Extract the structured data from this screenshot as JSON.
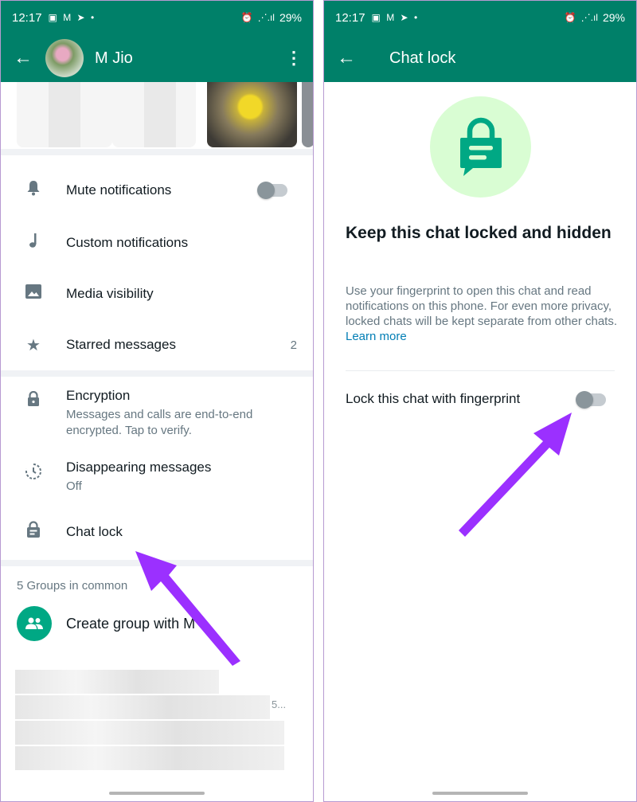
{
  "left": {
    "status": {
      "time": "12:17",
      "battery": "29%"
    },
    "header": {
      "back": "←",
      "title": "M Jio",
      "menu": "⋮"
    },
    "rows": {
      "mute": {
        "label": "Mute notifications",
        "icon": "bell-icon"
      },
      "custom": {
        "label": "Custom notifications",
        "icon": "music-note-icon"
      },
      "media": {
        "label": "Media visibility",
        "icon": "image-icon"
      },
      "starred": {
        "label": "Starred messages",
        "count": "2",
        "icon": "star-icon"
      },
      "encryption": {
        "label": "Encryption",
        "sub": "Messages and calls are end-to-end encrypted. Tap to verify.",
        "icon": "lock-icon"
      },
      "disappearing": {
        "label": "Disappearing messages",
        "sub": "Off",
        "icon": "timer-icon"
      },
      "chatlock": {
        "label": "Chat lock",
        "icon": "chat-lock-icon"
      }
    },
    "groups": {
      "heading": "5 Groups in common",
      "create_label": "Create group with M",
      "blurred_tail": "5..."
    }
  },
  "right": {
    "status": {
      "time": "12:17",
      "battery": "29%"
    },
    "header": {
      "back": "←",
      "title": "Chat lock"
    },
    "heading": "Keep this chat locked and hidden",
    "description": "Use your fingerprint to open this chat and read notifications on this phone. For even more privacy, locked chats will be kept separate from other chats.",
    "learn_more": "Learn more",
    "lock_label": "Lock this chat with fingerprint",
    "lock_enabled": false
  },
  "colors": {
    "header": "#008069",
    "accent": "#00a884",
    "arrow": "#9b30ff",
    "link": "#027eb5"
  }
}
